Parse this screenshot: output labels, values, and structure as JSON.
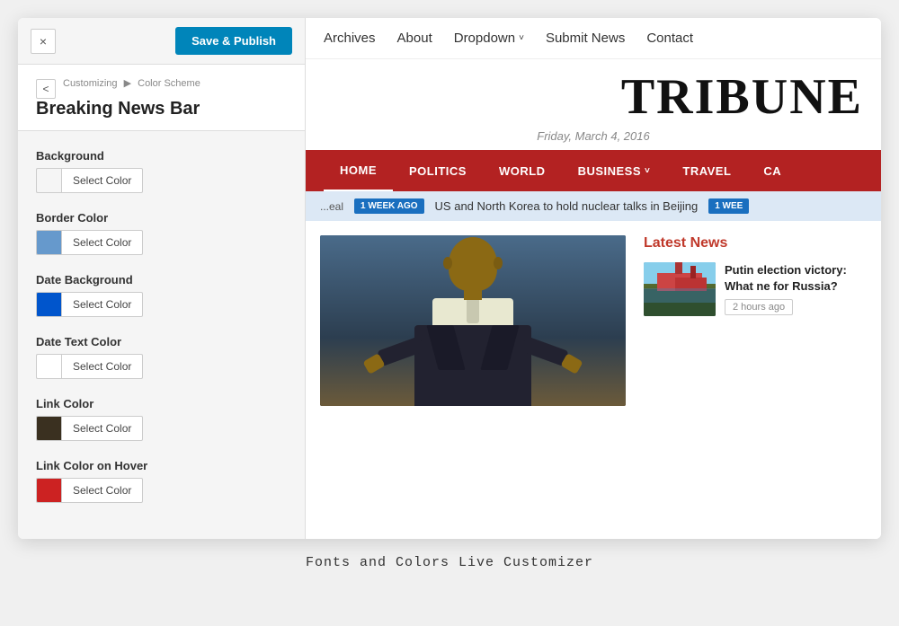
{
  "left_panel": {
    "close_btn_label": "×",
    "save_btn_label": "Save & Publish",
    "breadcrumb_back": "<",
    "breadcrumb_text": "Customizing",
    "breadcrumb_arrow": "▶",
    "breadcrumb_section": "Color Scheme",
    "panel_title": "Breaking News Bar",
    "color_options": [
      {
        "id": "background",
        "label": "Background",
        "color": "#f5f5f5",
        "btn_label": "Select Color"
      },
      {
        "id": "border-color",
        "label": "Border Color",
        "color": "#6699cc",
        "btn_label": "Select Color"
      },
      {
        "id": "date-background",
        "label": "Date Background",
        "color": "#0055cc",
        "btn_label": "Select Color"
      },
      {
        "id": "date-text-color",
        "label": "Date Text Color",
        "color": "#ffffff",
        "btn_label": "Select Color"
      },
      {
        "id": "link-color",
        "label": "Link Color",
        "color": "#3a3020",
        "btn_label": "Select Color"
      },
      {
        "id": "link-hover",
        "label": "Link Color on Hover",
        "color": "#cc2222",
        "btn_label": "Select Color"
      }
    ]
  },
  "right_panel": {
    "top_nav": {
      "items": [
        {
          "label": "Archives",
          "has_dropdown": false
        },
        {
          "label": "About",
          "has_dropdown": false
        },
        {
          "label": "Dropdown",
          "has_dropdown": true
        },
        {
          "label": "Submit News",
          "has_dropdown": false
        },
        {
          "label": "Contact",
          "has_dropdown": false
        }
      ]
    },
    "logo": "TRIBUNE",
    "date": "Friday, March 4, 2016",
    "main_nav": {
      "items": [
        {
          "label": "HOME",
          "active": true
        },
        {
          "label": "POLITICS",
          "active": false
        },
        {
          "label": "WORLD",
          "active": false
        },
        {
          "label": "BUSINESS",
          "active": false,
          "has_dropdown": true
        },
        {
          "label": "TRAVEL",
          "active": false
        },
        {
          "label": "CA",
          "active": false
        }
      ]
    },
    "breaking_news": {
      "badge": "1 WEEK AGO",
      "text": "US and North Korea to hold nuclear talks in Beijing",
      "badge2": "1 WEE"
    },
    "latest_news": {
      "title": "Latest News",
      "items": [
        {
          "headline": "Putin election victory: What ne for Russia?",
          "time": "2 hours ago"
        }
      ]
    }
  },
  "caption": "Fonts and Colors Live Customizer"
}
